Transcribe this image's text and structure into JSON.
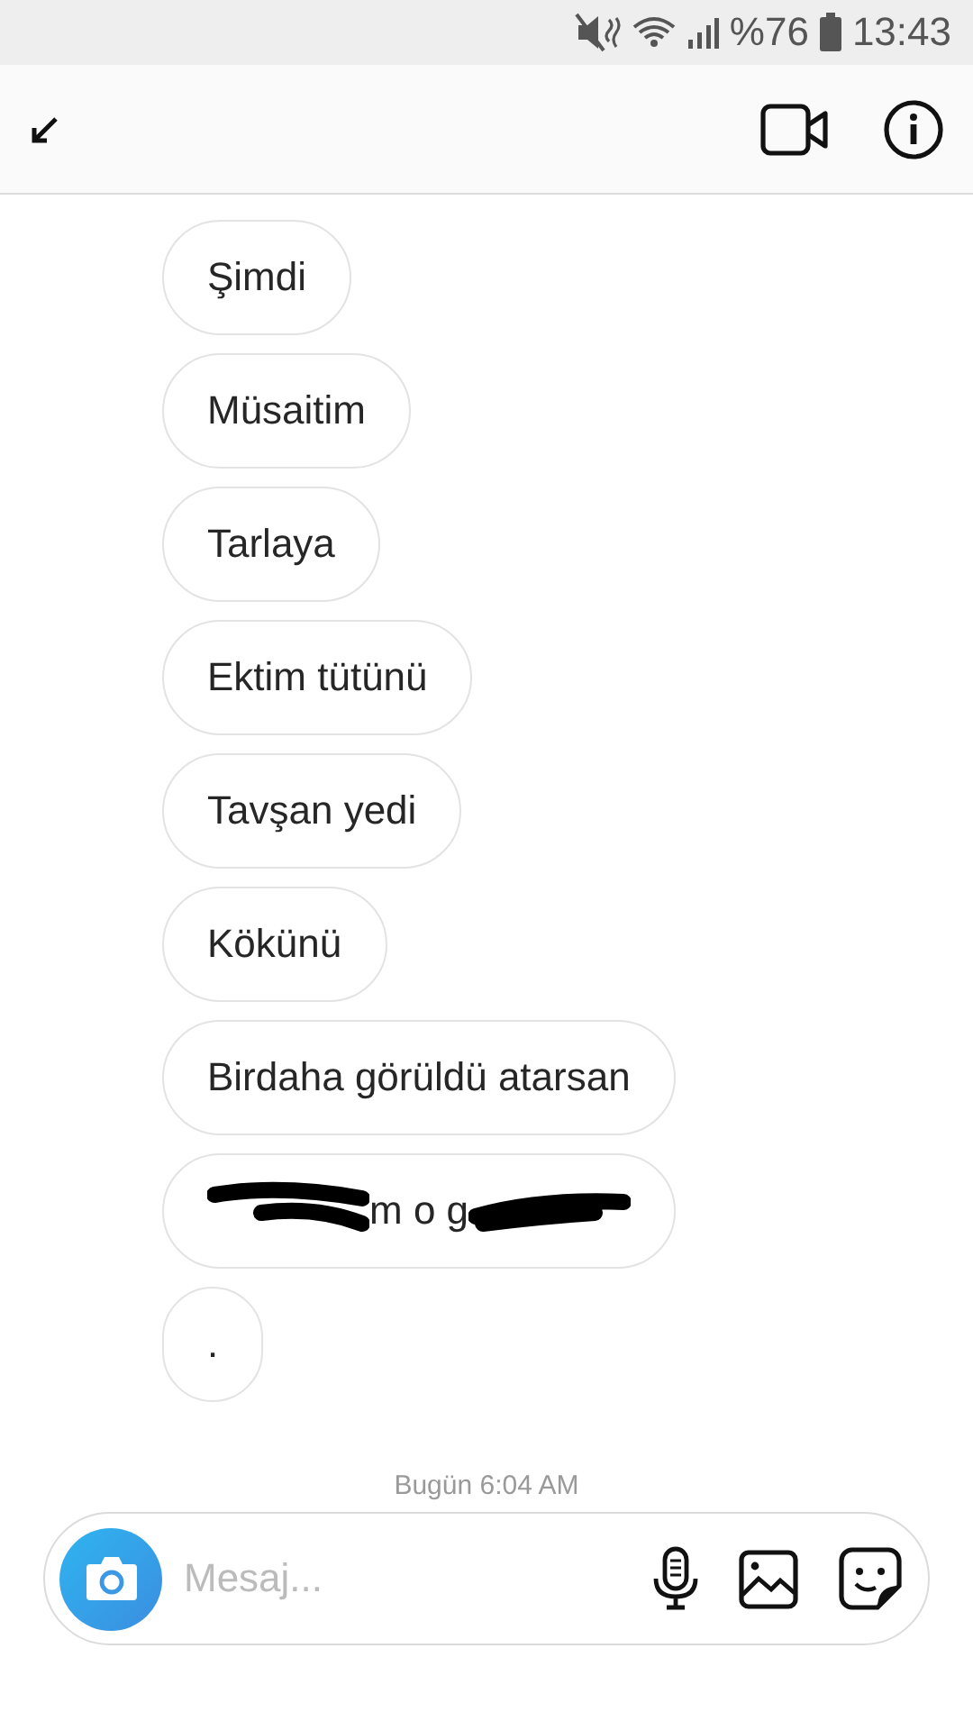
{
  "status_bar": {
    "battery": "%76",
    "time": "13:43"
  },
  "messages": [
    {
      "kind": "text",
      "text": "Şimdi"
    },
    {
      "kind": "text",
      "text": "Müsaitim"
    },
    {
      "kind": "text",
      "text": "Tarlaya"
    },
    {
      "kind": "text",
      "text": "Ektim tütünü"
    },
    {
      "kind": "text",
      "text": "Tavşan yedi"
    },
    {
      "kind": "text",
      "text": "Kökünü"
    },
    {
      "kind": "text",
      "text": "Birdaha görüldü atarsan"
    },
    {
      "kind": "redacted",
      "text": "m o g"
    },
    {
      "kind": "text",
      "text": "."
    }
  ],
  "timestamp": "Bugün 6:04 AM",
  "composer": {
    "placeholder": "Mesaj..."
  }
}
